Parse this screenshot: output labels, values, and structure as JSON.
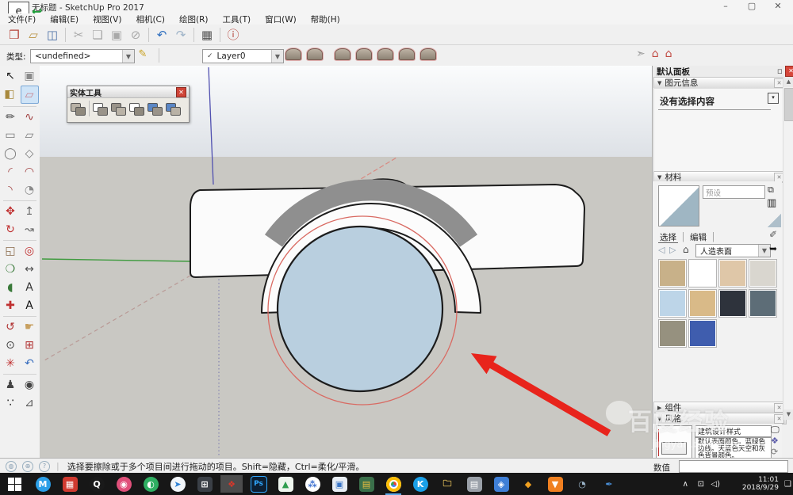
{
  "window": {
    "title": "无标题 - SketchUp Pro 2017",
    "controls": {
      "minimize": "–",
      "maximize": "▢",
      "close": "✕"
    },
    "overlay_widget": {
      "window_glyph": "e",
      "arrow_glyph": "↩"
    }
  },
  "menu": {
    "items": [
      "文件(F)",
      "编辑(E)",
      "视图(V)",
      "相机(C)",
      "绘图(R)",
      "工具(T)",
      "窗口(W)",
      "帮助(H)"
    ]
  },
  "toolbar_main": {
    "icons": [
      {
        "name": "new-file-icon",
        "glyph": "❒",
        "color": "#b5443a"
      },
      {
        "name": "open-file-icon",
        "glyph": "▱",
        "color": "#b9913f"
      },
      {
        "name": "save-icon",
        "glyph": "◫",
        "color": "#4a6fa5"
      },
      {
        "name": "sep"
      },
      {
        "name": "cut-icon",
        "glyph": "✂",
        "color": "#a9a9a9"
      },
      {
        "name": "copy-icon",
        "glyph": "❏",
        "color": "#a9a9a9"
      },
      {
        "name": "paste-icon",
        "glyph": "▣",
        "color": "#a9a9a9"
      },
      {
        "name": "erase-icon",
        "glyph": "⊘",
        "color": "#a9a9a9"
      },
      {
        "name": "sep"
      },
      {
        "name": "undo-icon",
        "glyph": "↶",
        "color": "#2f6fbf"
      },
      {
        "name": "redo-icon",
        "glyph": "↷",
        "color": "#9fb4c8"
      },
      {
        "name": "sep"
      },
      {
        "name": "print-icon",
        "glyph": "▦",
        "color": "#555555"
      },
      {
        "name": "sep"
      },
      {
        "name": "model-info-icon",
        "glyph": "ⓘ",
        "color": "#b5443a"
      }
    ]
  },
  "toolbar_second": {
    "type_label": "类型:",
    "type_value": "<undefined>",
    "edit_type_glyph": "✎",
    "layer_check": "✓",
    "layer_value": "Layer0",
    "sandbox_icons": [
      "from-contours-icon",
      "from-scratch-icon",
      "smoove-icon",
      "stamp-icon",
      "drape-icon",
      "add-detail-icon",
      "flip-edge-icon"
    ],
    "right_icons": [
      {
        "name": "select-cursor-icon",
        "glyph": "➣",
        "color": "#9a9a9a"
      },
      {
        "name": "get-models-icon",
        "glyph": "⌂",
        "color": "#c04840"
      },
      {
        "name": "share-model-icon",
        "glyph": "⌂",
        "color": "#c04840"
      }
    ]
  },
  "solid_tools": {
    "title": "实体工具",
    "close_glyph": "✕",
    "icons": [
      {
        "name": "outer-shell-icon",
        "c1": "#b9b2a6",
        "c2": "#8f897d"
      },
      {
        "name": "intersect-icon",
        "c1": "#ffffff",
        "c2": "#9a948a"
      },
      {
        "name": "union-icon",
        "c1": "#9a948a",
        "c2": "#b9b2a6"
      },
      {
        "name": "subtract-icon",
        "c1": "#ffffff",
        "c2": "#8f897d"
      },
      {
        "name": "trim-icon",
        "c1": "#5b87c5",
        "c2": "#9a948a"
      },
      {
        "name": "split-icon",
        "c1": "#5b87c5",
        "c2": "#b9b2a6"
      }
    ]
  },
  "left_tools": {
    "rows": [
      [
        {
          "name": "select-tool",
          "glyph": "↖",
          "color": "#222"
        },
        {
          "name": "make-component-tool",
          "glyph": "▣",
          "color": "#8a8a8a"
        }
      ],
      [
        {
          "name": "paint-bucket-tool",
          "glyph": "◧",
          "color": "#a8893d"
        },
        {
          "name": "eraser-tool",
          "glyph": "▱",
          "color": "#c87f8a",
          "active": true
        }
      ],
      [
        {
          "name": "line-tool",
          "glyph": "✏",
          "color": "#444"
        },
        {
          "name": "freehand-tool",
          "glyph": "∿",
          "color": "#a04040"
        }
      ],
      [
        {
          "name": "rectangle-tool",
          "glyph": "▭",
          "color": "#777"
        },
        {
          "name": "rotated-rectangle-tool",
          "glyph": "▱",
          "color": "#777"
        }
      ],
      [
        {
          "name": "circle-tool",
          "glyph": "◯",
          "color": "#777"
        },
        {
          "name": "polygon-tool",
          "glyph": "◇",
          "color": "#777"
        }
      ],
      [
        {
          "name": "arc-tool",
          "glyph": "◜",
          "color": "#a04040"
        },
        {
          "name": "two-point-arc-tool",
          "glyph": "◠",
          "color": "#a04040"
        }
      ],
      [
        {
          "name": "three-point-arc-tool",
          "glyph": "◝",
          "color": "#a04040"
        },
        {
          "name": "pie-tool",
          "glyph": "◔",
          "color": "#8a8a8a"
        }
      ],
      [
        {
          "name": "move-tool",
          "glyph": "✥",
          "color": "#c03030"
        },
        {
          "name": "push-pull-tool",
          "glyph": "↥",
          "color": "#666"
        }
      ],
      [
        {
          "name": "rotate-tool",
          "glyph": "↻",
          "color": "#c03030"
        },
        {
          "name": "follow-me-tool",
          "glyph": "↝",
          "color": "#666"
        }
      ],
      [
        {
          "name": "scale-tool",
          "glyph": "◱",
          "color": "#8a6a4a"
        },
        {
          "name": "offset-tool",
          "glyph": "◎",
          "color": "#c03030"
        }
      ],
      [
        {
          "name": "tape-measure-tool",
          "glyph": "❍",
          "color": "#3a7a3a"
        },
        {
          "name": "dimension-tool",
          "glyph": "↔",
          "color": "#555"
        }
      ],
      [
        {
          "name": "protractor-tool",
          "glyph": "◖",
          "color": "#3a7a3a"
        },
        {
          "name": "text-tool",
          "glyph": "A",
          "color": "#333"
        }
      ],
      [
        {
          "name": "axes-tool",
          "glyph": "✚",
          "color": "#c03030"
        },
        {
          "name": "threed-text-tool",
          "glyph": "A",
          "color": "#111"
        }
      ],
      [
        {
          "name": "orbit-tool",
          "glyph": "↺",
          "color": "#b03030"
        },
        {
          "name": "pan-tool",
          "glyph": "☛",
          "color": "#c8a060"
        }
      ],
      [
        {
          "name": "zoom-tool",
          "glyph": "⊙",
          "color": "#444"
        },
        {
          "name": "zoom-window-tool",
          "glyph": "⊞",
          "color": "#b03030"
        }
      ],
      [
        {
          "name": "zoom-extents-tool",
          "glyph": "✳",
          "color": "#c03030"
        },
        {
          "name": "previous-view-tool",
          "glyph": "↶",
          "color": "#3a6fbf"
        }
      ],
      [
        {
          "name": "position-camera-tool",
          "glyph": "♟",
          "color": "#444"
        },
        {
          "name": "look-around-tool",
          "glyph": "◉",
          "color": "#444"
        }
      ],
      [
        {
          "name": "walk-tool",
          "glyph": "∵",
          "color": "#222"
        },
        {
          "name": "section-plane-tool",
          "glyph": "⊿",
          "color": "#555"
        }
      ]
    ],
    "separators_after": [
      1,
      6,
      8,
      12,
      15
    ]
  },
  "right_panel": {
    "title": "默认面板",
    "pin_glyph": "▫",
    "close_glyph": "✕",
    "entity_info": {
      "header": "图元信息",
      "collapse_glyph": "▼",
      "empty_text": "没有选择内容",
      "detail_glyph": "▾"
    },
    "materials": {
      "header": "材料",
      "collapse_glyph": "▼",
      "name_placeholder": "预设",
      "display_in_model_glyph": "⧉",
      "create_material_glyph": "▥",
      "tabs": [
        "选择",
        "编辑"
      ],
      "eyedropper_glyph": "✐",
      "back_glyph": "◁",
      "forward_glyph": "▷",
      "home_glyph": "⌂",
      "collection_value": "人造表面",
      "detail_arrow_glyph": "➥",
      "swatches": [
        "#c8b189",
        "#ffffff",
        "#dfc7a8",
        "#d9d6cf",
        "#bdd5e8",
        "#d9ba88",
        "#2e333c",
        "#5d6d77",
        "#96917f",
        "#3f5dae"
      ],
      "preview_colors": {
        "top": "#ffffff",
        "bottom": "#9fb6c3"
      }
    },
    "components": {
      "header": "组件",
      "collapse_glyph": "▶"
    },
    "styles": {
      "header": "风格",
      "collapse_glyph": "▼",
      "name_value": "建筑设计样式",
      "description": "默认表面颜色。蓝绿色边线。天蓝色天空和灰色背景颜色。",
      "display_glyph": "🖵",
      "mix_glyph": "❖",
      "refresh_glyph": "⟳"
    },
    "scrollbar": {
      "up_glyph": "▲",
      "down_glyph": "▼"
    }
  },
  "measurements": {
    "label": "数值",
    "value": ""
  },
  "status_bar": {
    "icons": [
      {
        "name": "geolocation-icon",
        "glyph": "◍"
      },
      {
        "name": "credits-icon",
        "glyph": "⊕"
      },
      {
        "name": "help-icon",
        "glyph": "?"
      }
    ],
    "text": "选择要擦除或于多个项目间进行拖动的项目。Shift=隐藏，Ctrl=柔化/平滑。"
  },
  "taskbar": {
    "start_name": "start-button",
    "items": [
      {
        "name": "blue-circle-app-icon",
        "glyph": "M",
        "bg": "#2b9fe8",
        "fg": "#ffffff",
        "round": true
      },
      {
        "name": "red-square-app-icon",
        "glyph": "▦",
        "bg": "#d03a30",
        "fg": "#ffffff"
      },
      {
        "name": "qq-icon",
        "glyph": "Q",
        "bg": "#1a1a1a",
        "fg": "#ffffff",
        "round": true
      },
      {
        "name": "pink-circle-app-icon",
        "glyph": "◉",
        "bg": "#e0507a",
        "fg": "#ffffff",
        "round": true
      },
      {
        "name": "green-swirl-app-icon",
        "glyph": "◐",
        "bg": "#2fae62",
        "fg": "#ffffff",
        "round": true
      },
      {
        "name": "thunder-bird-icon",
        "glyph": "➤",
        "bg": "#f2f6fa",
        "fg": "#2a7fd4",
        "round": true
      },
      {
        "name": "calculator-icon",
        "glyph": "⊞",
        "bg": "#3a3f46",
        "fg": "#ffffff"
      },
      {
        "name": "sketchup-taskbar-icon",
        "glyph": "❖",
        "bg": "#00000000",
        "fg": "#d8372a",
        "active": true
      },
      {
        "name": "photoshop-icon",
        "glyph": "Ps",
        "bg": "#0c1f33",
        "fg": "#31a8ff",
        "border": "#31a8ff"
      },
      {
        "name": "green-landscape-app-icon",
        "glyph": "▲",
        "bg": "#eef5ee",
        "fg": "#2f9e4f"
      },
      {
        "name": "circles-app-icon",
        "glyph": "⁂",
        "bg": "#ffffff",
        "fg": "#3a6fd0",
        "round": true
      },
      {
        "name": "screenshot-app-icon",
        "glyph": "▣",
        "bg": "#e8eef5",
        "fg": "#3a76c8"
      },
      {
        "name": "colorful-app-icon",
        "glyph": "▤",
        "bg": "#3a6f4a",
        "fg": "#f0c040"
      },
      {
        "name": "chrome-icon",
        "glyph": "",
        "bg": "chrome",
        "fg": "#ffffff",
        "underline": true
      },
      {
        "name": "kugou-icon",
        "glyph": "K",
        "bg": "#1aa0e8",
        "fg": "#ffffff",
        "round": true
      },
      {
        "name": "file-explorer-icon",
        "glyph": "🗀",
        "bg": "#00000000",
        "fg": "#e8c25a"
      },
      {
        "name": "gray-app-icon",
        "glyph": "▤",
        "bg": "#9aa0a8",
        "fg": "#ffffff"
      },
      {
        "name": "blue-shirt-app-icon",
        "glyph": "◈",
        "bg": "#3f7fd6",
        "fg": "#ffffff"
      },
      {
        "name": "orange-app-icon",
        "glyph": "◆",
        "bg": "#00000000",
        "fg": "#f0a020"
      },
      {
        "name": "security-shield-icon",
        "glyph": "▼",
        "bg": "#f08020",
        "fg": "#ffffff"
      },
      {
        "name": "dish-app-icon",
        "glyph": "◔",
        "bg": "#00000000",
        "fg": "#9ab4c8"
      },
      {
        "name": "pin-app-icon",
        "glyph": "✒",
        "bg": "#00000000",
        "fg": "#4a90d9"
      }
    ],
    "tray": {
      "chevron": "∧",
      "network_glyph": "⊡",
      "speaker_glyph": "◁)",
      "time": "11:01",
      "date": "2018/9/29",
      "bubble_glyph": "❑"
    }
  },
  "watermark": {
    "line1": "百度经验",
    "line2": "jingyan.baidu.com"
  },
  "viewport": {
    "colors": {
      "sky_top": "#fbfcfd",
      "sky_bottom": "#dde1e6",
      "ground": "#c9c8c3",
      "bar_fill": "#fbfbfb",
      "outline": "#1c1c1c",
      "shade_gray": "#8f8f8f",
      "disk_fill": "#b9cfdf",
      "guide_red": "#d96a62",
      "arrow_red": "#e8241c",
      "axis_blue": "#5050b0",
      "axis_green": "#3f9b3f",
      "axis_red": "#d98880",
      "axis_red_back": "#b99a96"
    }
  }
}
